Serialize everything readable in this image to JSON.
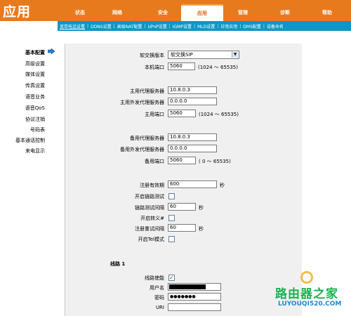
{
  "app": {
    "title": "应用"
  },
  "tabs": [
    {
      "label": "状态"
    },
    {
      "label": "网络"
    },
    {
      "label": "安全"
    },
    {
      "label": "应用",
      "active": true
    },
    {
      "label": "管理"
    },
    {
      "label": "诊断"
    },
    {
      "label": "帮助"
    }
  ],
  "subnav": [
    {
      "label": "宽带电话设置",
      "active": true
    },
    {
      "label": "DDNS设置"
    },
    {
      "label": "高级NAT配置"
    },
    {
      "label": "UPnP设置"
    },
    {
      "label": "IGMP设置"
    },
    {
      "label": "MLD设置"
    },
    {
      "label": "日常应用"
    },
    {
      "label": "DMS配置"
    },
    {
      "label": "设备命名"
    }
  ],
  "sidebar": {
    "items": [
      {
        "label": "基本配置",
        "active": true
      },
      {
        "label": "高级设置"
      },
      {
        "label": "媒体设置"
      },
      {
        "label": "传真设置"
      },
      {
        "label": "语音业务"
      },
      {
        "label": "语音QoS"
      },
      {
        "label": "协议注销"
      },
      {
        "label": "号码表"
      },
      {
        "label": "基本通话控制"
      },
      {
        "label": "来电显示"
      }
    ]
  },
  "form": {
    "softswitch": {
      "label": "软交换版本",
      "value": "软交换SIP"
    },
    "local_port": {
      "label": "本机端口",
      "value": "5060",
      "hint": "(1024 ～ 65535)"
    },
    "primary": {
      "proxy": {
        "label": "主用代理服务器",
        "value": "10.8.0.3"
      },
      "outbound": {
        "label": "主用外发代理服务器",
        "value": "0.0.0.0"
      },
      "port": {
        "label": "主用端口",
        "value": "5060",
        "hint": "(1024 ～ 65535)"
      }
    },
    "backup": {
      "proxy": {
        "label": "备用代理服务器",
        "value": "10.8.0.3"
      },
      "outbound": {
        "label": "备用外发代理服务器",
        "value": "0.0.0.0"
      },
      "port": {
        "label": "备用端口",
        "value": "5060",
        "hint": "( 0 ～ 65535)"
      }
    },
    "reg_expiry": {
      "label": "注册有效期",
      "value": "600",
      "unit": "秒"
    },
    "link_test": {
      "label": "开启链路测试",
      "checked": false
    },
    "link_test_interval": {
      "label": "链路测试间隔",
      "value": "60",
      "unit": "秒"
    },
    "escape": {
      "label": "开启转义#",
      "checked": false
    },
    "reg_retry_interval": {
      "label": "注册重试间隔",
      "value": "60",
      "unit": "秒"
    },
    "tel_mode": {
      "label": "开启Tel模式",
      "checked": false
    }
  },
  "line1": {
    "title": "线路 1",
    "enable": {
      "label": "线路使能",
      "checked": true
    },
    "username": {
      "label": "用户名",
      "value": ""
    },
    "password": {
      "label": "密码",
      "value": "●●●●●●●"
    },
    "uri": {
      "label": "URI",
      "value": ""
    }
  },
  "watermark": {
    "logo": "路由器之家",
    "url": "LUYOUQI520.COM"
  },
  "colors": {
    "header": "#e87a1e",
    "subnav": "#0e97c6",
    "panel": "#f0f0f0"
  }
}
